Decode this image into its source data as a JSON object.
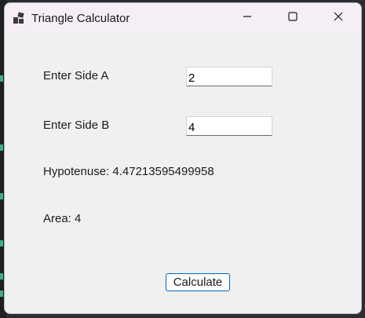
{
  "window": {
    "title": "Triangle Calculator",
    "accent": "#0067c0",
    "titlebar_color": "#f5eef6",
    "background": "#f0f0f0"
  },
  "titlebar_buttons": {
    "minimize_icon": "minimize-icon",
    "maximize_icon": "maximize-icon",
    "close_icon": "close-icon"
  },
  "form": {
    "side_a_label": "Enter Side A",
    "side_a_value": "2",
    "side_b_label": "Enter Side B",
    "side_b_value": "4",
    "hypotenuse_text": "Hypotenuse: 4.47213595499958",
    "area_text": "Area: 4",
    "calculate_label": "Calculate"
  }
}
